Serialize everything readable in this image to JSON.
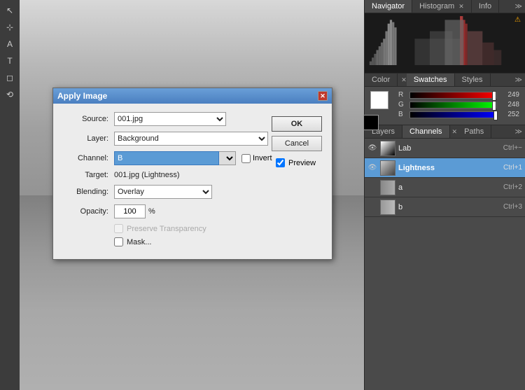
{
  "dialog": {
    "title": "Apply Image",
    "source_label": "Source:",
    "source_value": "001.jpg",
    "layer_label": "Layer:",
    "layer_value": "Background",
    "channel_label": "Channel:",
    "channel_value": "B",
    "invert_label": "Invert",
    "target_label": "Target:",
    "target_value": "001.jpg (Lightness)",
    "blending_label": "Blending:",
    "blending_value": "Overlay",
    "opacity_label": "Opacity:",
    "opacity_value": "100",
    "opacity_unit": "%",
    "preserve_label": "Preserve Transparency",
    "mask_label": "Mask...",
    "ok_label": "OK",
    "cancel_label": "Cancel",
    "preview_label": "Preview"
  },
  "right_panel": {
    "navigator_tab": "Navigator",
    "histogram_tab": "Histogram",
    "info_tab": "Info",
    "color_tab": "Color",
    "swatches_tab": "Swatches",
    "styles_tab": "Styles",
    "layers_tab": "Layers",
    "channels_tab": "Channels",
    "paths_tab": "Paths"
  },
  "color": {
    "r_value": "249",
    "g_value": "248",
    "b_value": "252",
    "r_pct": 97.6,
    "g_pct": 97.3,
    "b_pct": 98.8
  },
  "channels": {
    "items": [
      {
        "name": "Lab",
        "shortcut": "Ctrl+~",
        "active": false
      },
      {
        "name": "Lightness",
        "shortcut": "Ctrl+1",
        "active": true
      },
      {
        "name": "a",
        "shortcut": "Ctrl+2",
        "active": false
      },
      {
        "name": "b",
        "shortcut": "Ctrl+3",
        "active": false
      }
    ]
  },
  "toolbar": {
    "tools": [
      "✦",
      "⊹",
      "A",
      "T",
      "◻",
      "⟲"
    ]
  }
}
